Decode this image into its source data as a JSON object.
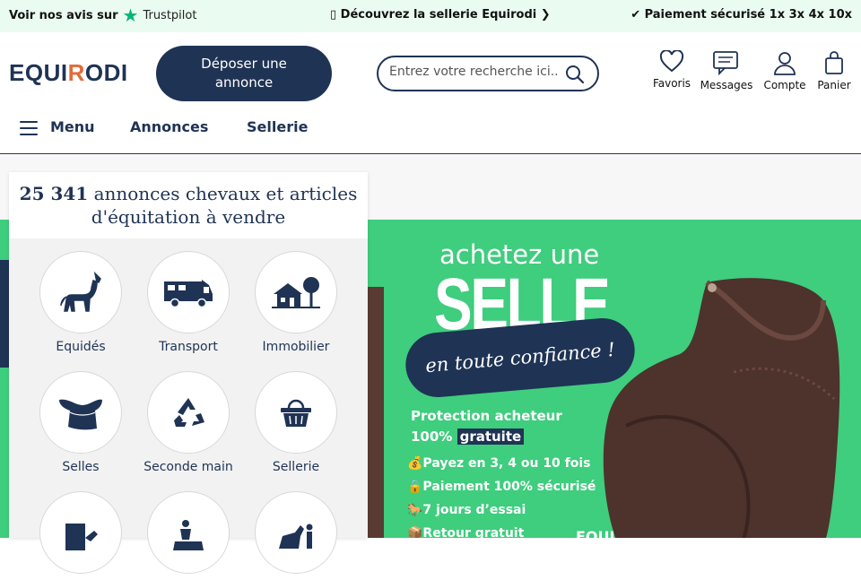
{
  "topbar": {
    "reviews_prefix": "Voir nos avis sur",
    "trustpilot": "Trustpilot",
    "center": "▯ Découvrez la sellerie Equirodi ❯",
    "right": "✔ Paiement sécurisé 1x 3x 4x 10x"
  },
  "header": {
    "logo_a": "EQUI",
    "logo_o": "R",
    "logo_b": "ODI",
    "post_line1": "Déposer une",
    "post_line2": "annonce",
    "search_placeholder": "Entrez votre recherche ici...",
    "icons": {
      "favoris": "Favoris",
      "messages": "Messages",
      "compte": "Compte",
      "panier": "Panier"
    }
  },
  "nav": {
    "menu": "Menu",
    "annonces": "Annonces",
    "sellerie": "Sellerie"
  },
  "panel": {
    "count": "25 341",
    "title_rest": "annonces chevaux et articles",
    "title_line2": "d'équitation à vendre",
    "categories": [
      {
        "label": "Equidés",
        "icon": "horse-icon"
      },
      {
        "label": "Transport",
        "icon": "truck-icon"
      },
      {
        "label": "Immobilier",
        "icon": "house-icon"
      },
      {
        "label": "Selles",
        "icon": "saddle-icon"
      },
      {
        "label": "Seconde main",
        "icon": "recycle-icon"
      },
      {
        "label": "Sellerie",
        "icon": "basket-icon"
      }
    ]
  },
  "banner": {
    "line1": "achetez une",
    "line2": "SELLE",
    "pill": "en toute confiance !",
    "prot_line1": "Protection acheteur",
    "prot_pct": "100%",
    "prot_hl": "gratuite",
    "bullets": [
      "💰Payez en 3, 4 ou 10 fois",
      "🔒Paiement 100% sécurisé",
      "🐎7 jours d’essai",
      "📦Retour gratuit"
    ],
    "brand": "EQUIRODI",
    "colors": {
      "green": "#3fcd7e",
      "navy": "#1f3354",
      "saddle": "#4e322c"
    }
  }
}
